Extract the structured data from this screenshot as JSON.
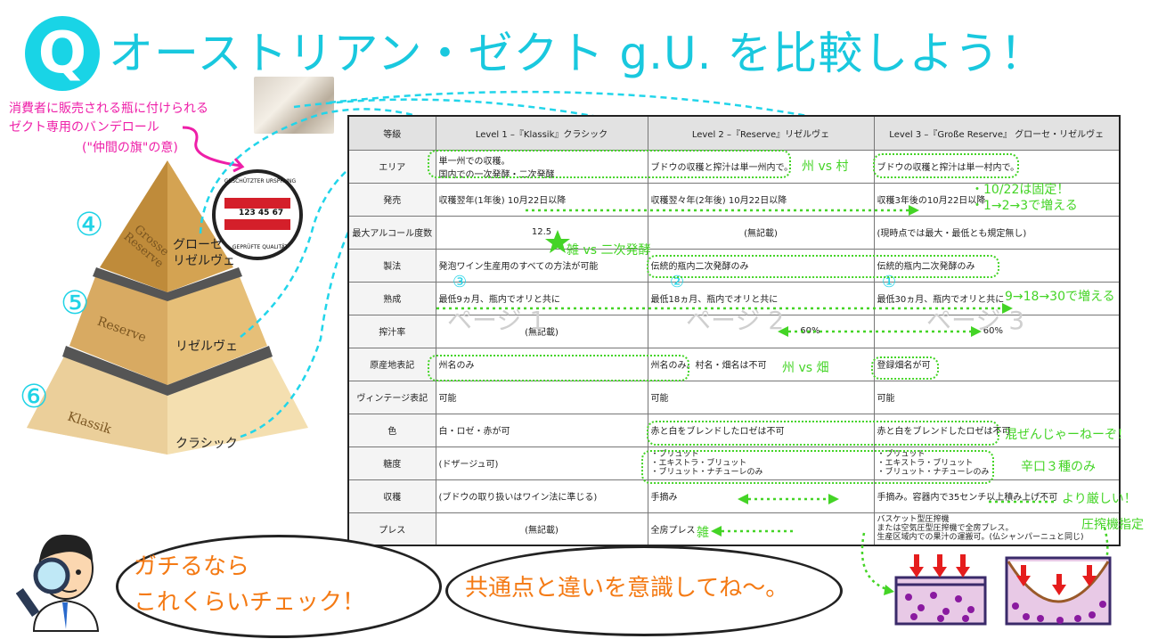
{
  "title": {
    "q": "Q",
    "text": "オーストリアン・ゼクト g.U. を比較しよう！"
  },
  "note": {
    "line1": "消費者に販売される瓶に付けられる",
    "line2": "ゼクト専用のバンデロール",
    "line3": "(\"仲間の旗\"の意)"
  },
  "seal": {
    "top": "GESCHÜTZTER URSPRUNG",
    "bottom": "GEPRÜFTE QUALITÄT",
    "number": "123 45 67"
  },
  "pyramid": {
    "levels": [
      {
        "num": "④",
        "name": "Grosse Reserve",
        "jp": "グローセ リゼルヴェ"
      },
      {
        "num": "⑤",
        "name": "Reserve",
        "jp": "リゼルヴェ"
      },
      {
        "num": "⑥",
        "name": "Klassik",
        "jp": "クラシック"
      }
    ]
  },
  "table": {
    "headers": [
      "等級",
      "Level 1 –『Klassik』クラシック",
      "Level 2 –『Reserve』リゼルヴェ",
      "Level 3 –『Große Reserve』 グローセ・リゼルヴェ"
    ],
    "rows": [
      {
        "label": "エリア",
        "c1": "単一州での収穫。",
        "c1b": "国内での一次発酵・二次発酵",
        "c2": "ブドウの収穫と搾汁は単一州内で。",
        "c3": "ブドウの収穫と搾汁は単一村内で。"
      },
      {
        "label": "発売",
        "c1": "収穫翌年(1年後) 10月22日以降",
        "c2": "収穫翌々年(2年後) 10月22日以降",
        "c3": "収穫3年後の10月22日以降"
      },
      {
        "label": "最大アルコール度数",
        "c1": "12.5",
        "c2": "(無記載)",
        "c3": "(現時点では最大・最低とも規定無し)"
      },
      {
        "label": "製法",
        "c1": "発泡ワイン生産用のすべての方法が可能",
        "c2": "伝統的瓶内二次発酵のみ",
        "c3": "伝統的瓶内二次発酵のみ"
      },
      {
        "label": "熟成",
        "c1": "最低9ヵ月、瓶内でオリと共に",
        "c2": "最低18ヵ月、瓶内でオリと共に",
        "c3": "最低30ヵ月、瓶内でオリと共に"
      },
      {
        "label": "搾汁率",
        "c1": "(無記載)",
        "c2": "60%",
        "c3": "60%"
      },
      {
        "label": "原産地表記",
        "c1": "州名のみ",
        "c2": "州名のみ。村名・畑名は不可",
        "c3": "登録畑名が可"
      },
      {
        "label": "ヴィンテージ表記",
        "c1": "可能",
        "c2": "可能",
        "c3": "可能"
      },
      {
        "label": "色",
        "c1": "白・ロゼ・赤が可",
        "c2": "赤と白をブレンドしたロゼは不可",
        "c3": "赤と白をブレンドしたロゼは不可"
      },
      {
        "label": "糖度",
        "c1": "(ドザージュ可)",
        "c2": "・ブリュット\n・エキストラ・ブリュット\n・ブリュット・ナチューレのみ",
        "c3": "・ブリュット\n・エキストラ・ブリュット\n・ブリュット・ナチューレのみ"
      },
      {
        "label": "収穫",
        "c1": "(ブドウの取り扱いはワイン法に準じる)",
        "c2": "手摘み",
        "c3": "手摘み。容器内で35センチ以上積み上げ不可"
      },
      {
        "label": "プレス",
        "c1": "(無記載)",
        "c2": "全房プレス",
        "c3": "バスケット型圧搾機\nまたは空気圧型圧搾機で全房プレス。\n生産区域内での果汁の運搬可。(仏シャンパーニュと同じ)"
      }
    ],
    "watermarks": [
      "ページ 1",
      "ページ 2",
      "ページ 3"
    ],
    "circle_nums": [
      "③",
      "②",
      "①"
    ]
  },
  "annotations": {
    "a1": "州 vs 村",
    "a2a": "・10/22は固定！",
    "a2b": "・1→2→3で増える",
    "a3": "雑 vs 二次発酵",
    "a4": "9→18→30で増える",
    "a5": "州 vs 畑",
    "a6": "混ぜんじゃーねーぞ！",
    "a7": "辛口３種のみ",
    "a8": "より厳しい！",
    "a9": "雑",
    "a10": "圧搾機指定"
  },
  "bubbles": {
    "left1": "ガチるなら",
    "left2": "これくらいチェック！",
    "right": "共通点と違いを意識してね～。"
  },
  "colors": {
    "cyan": "#19d4e6",
    "pink": "#ee1fa8",
    "green": "#44d426",
    "orange": "#f47a14",
    "red": "#e02020"
  }
}
